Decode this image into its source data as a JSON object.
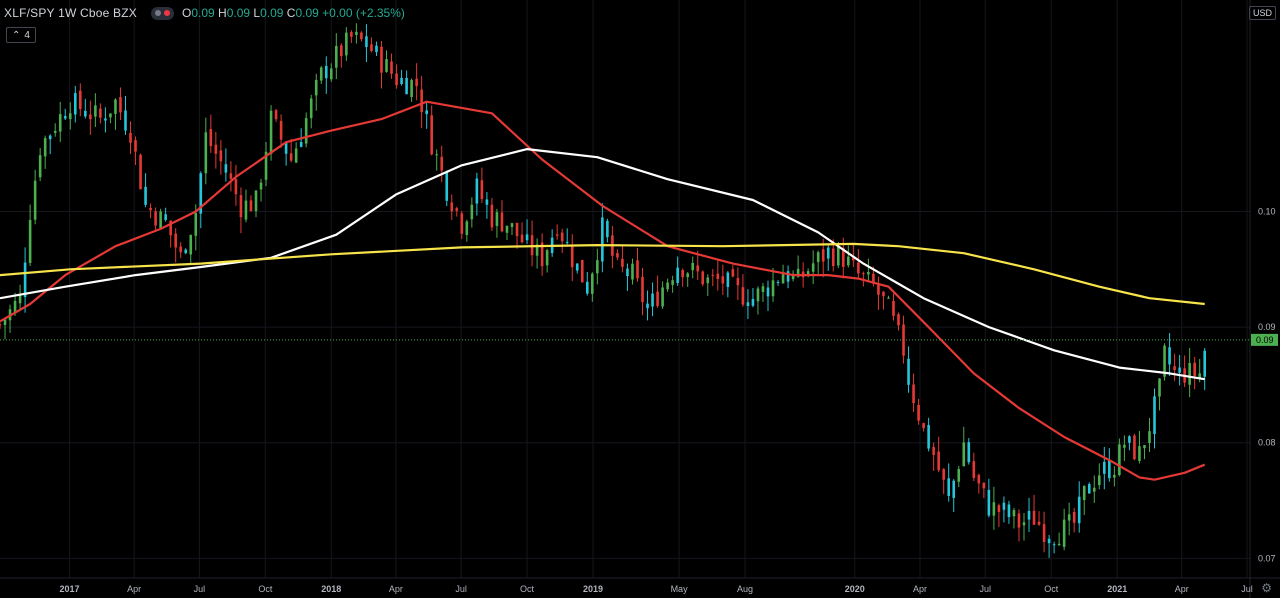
{
  "header": {
    "symbol_title": "XLF/SPY  1W  Cboe BZX",
    "ohlc": {
      "o_label": "O",
      "o": "0.09",
      "h_label": "H",
      "h": "0.09",
      "l_label": "L",
      "l": "0.09",
      "c_label": "C",
      "c": "0.09",
      "change": "+0.00 (+2.35%)"
    }
  },
  "indicators_collapse": {
    "count": "4"
  },
  "price_scale": {
    "currency": "USD",
    "last_price_label": "0.09",
    "last_price": 0.0889
  },
  "colors": {
    "background": "#000000",
    "up": "#4caf50",
    "up_alt": "#26c6da",
    "down": "#e53935",
    "ma_short": "#e53935",
    "ma_medium": "#ffffff",
    "ma_long": "#f7e34a",
    "last_price": "#4caf50"
  },
  "chart_data": {
    "type": "candlestick",
    "timeframe": "1W",
    "ylim": [
      0.0683,
      0.1183
    ],
    "y_ticks": [
      {
        "value": 0.1,
        "label": "0.10"
      },
      {
        "value": 0.09,
        "label": "0.09"
      },
      {
        "value": 0.08,
        "label": "0.08"
      },
      {
        "value": 0.07,
        "label": "0.07"
      }
    ],
    "x_range": [
      "2016-09-26",
      "2021-08-16"
    ],
    "x_ticks": [
      {
        "date": "2017-01-01",
        "label": "2017",
        "major": true
      },
      {
        "date": "2017-04-01",
        "label": "Apr"
      },
      {
        "date": "2017-07-01",
        "label": "Jul"
      },
      {
        "date": "2017-10-01",
        "label": "Oct"
      },
      {
        "date": "2018-01-01",
        "label": "2018",
        "major": true
      },
      {
        "date": "2018-04-01",
        "label": "Apr"
      },
      {
        "date": "2018-07-01",
        "label": "Jul"
      },
      {
        "date": "2018-10-01",
        "label": "Oct"
      },
      {
        "date": "2019-01-01",
        "label": "2019",
        "major": true
      },
      {
        "date": "2019-05-01",
        "label": "May"
      },
      {
        "date": "2019-08-01",
        "label": "Aug"
      },
      {
        "date": "2020-01-01",
        "label": "2020",
        "major": true
      },
      {
        "date": "2020-04-01",
        "label": "Apr"
      },
      {
        "date": "2020-07-01",
        "label": "Jul"
      },
      {
        "date": "2020-10-01",
        "label": "Oct"
      },
      {
        "date": "2021-01-01",
        "label": "2021",
        "major": true
      },
      {
        "date": "2021-04-01",
        "label": "Apr"
      },
      {
        "date": "2021-07-01",
        "label": "Jul"
      }
    ],
    "close_path": [
      [
        "2016-09-26",
        0.0902
      ],
      [
        "2016-10-24",
        0.0925
      ],
      [
        "2016-11-07",
        0.1001
      ],
      [
        "2016-11-21",
        0.1056
      ],
      [
        "2017-01-02",
        0.1095
      ],
      [
        "2017-02-13",
        0.108
      ],
      [
        "2017-03-06",
        0.1095
      ],
      [
        "2017-03-27",
        0.107
      ],
      [
        "2017-04-17",
        0.1005
      ],
      [
        "2017-05-15",
        0.099
      ],
      [
        "2017-06-05",
        0.096
      ],
      [
        "2017-06-26",
        0.1
      ],
      [
        "2017-07-10",
        0.1065
      ],
      [
        "2017-08-07",
        0.1035
      ],
      [
        "2017-08-28",
        0.1005
      ],
      [
        "2017-09-18",
        0.1008
      ],
      [
        "2017-10-09",
        0.108
      ],
      [
        "2017-11-06",
        0.1045
      ],
      [
        "2017-11-27",
        0.108
      ],
      [
        "2017-12-18",
        0.1118
      ],
      [
        "2018-01-29",
        0.115
      ],
      [
        "2018-02-19",
        0.1145
      ],
      [
        "2018-03-12",
        0.113
      ],
      [
        "2018-04-02",
        0.1115
      ],
      [
        "2018-04-30",
        0.111
      ],
      [
        "2018-05-21",
        0.106
      ],
      [
        "2018-06-11",
        0.102
      ],
      [
        "2018-07-02",
        0.099
      ],
      [
        "2018-07-23",
        0.102
      ],
      [
        "2018-08-13",
        0.0995
      ],
      [
        "2018-09-03",
        0.099
      ],
      [
        "2018-10-01",
        0.097
      ],
      [
        "2018-10-22",
        0.096
      ],
      [
        "2018-11-12",
        0.099
      ],
      [
        "2018-12-03",
        0.096
      ],
      [
        "2018-12-24",
        0.0935
      ],
      [
        "2019-01-14",
        0.0985
      ],
      [
        "2019-02-04",
        0.095
      ],
      [
        "2019-02-25",
        0.0945
      ],
      [
        "2019-03-18",
        0.0915
      ],
      [
        "2019-04-08",
        0.0935
      ],
      [
        "2019-04-29",
        0.0955
      ],
      [
        "2019-05-20",
        0.0948
      ],
      [
        "2019-06-10",
        0.094
      ],
      [
        "2019-07-01",
        0.094
      ],
      [
        "2019-07-22",
        0.093
      ],
      [
        "2019-08-12",
        0.0925
      ],
      [
        "2019-09-02",
        0.0935
      ],
      [
        "2019-09-23",
        0.0948
      ],
      [
        "2019-10-14",
        0.094
      ],
      [
        "2019-11-04",
        0.0955
      ],
      [
        "2019-11-25",
        0.0965
      ],
      [
        "2019-12-16",
        0.096
      ],
      [
        "2020-01-06",
        0.0945
      ],
      [
        "2020-01-27",
        0.0935
      ],
      [
        "2020-02-17",
        0.0915
      ],
      [
        "2020-03-09",
        0.088
      ],
      [
        "2020-03-16",
        0.0855
      ],
      [
        "2020-03-23",
        0.084
      ],
      [
        "2020-04-06",
        0.081
      ],
      [
        "2020-04-20",
        0.079
      ],
      [
        "2020-05-11",
        0.075
      ],
      [
        "2020-06-01",
        0.08
      ],
      [
        "2020-06-15",
        0.077
      ],
      [
        "2020-07-06",
        0.0745
      ],
      [
        "2020-07-27",
        0.074
      ],
      [
        "2020-08-17",
        0.073
      ],
      [
        "2020-09-07",
        0.0735
      ],
      [
        "2020-09-28",
        0.072
      ],
      [
        "2020-10-19",
        0.0725
      ],
      [
        "2020-11-02",
        0.073
      ],
      [
        "2020-11-16",
        0.0755
      ],
      [
        "2020-12-07",
        0.0775
      ],
      [
        "2020-12-28",
        0.078
      ],
      [
        "2021-01-11",
        0.08
      ],
      [
        "2021-02-01",
        0.079
      ],
      [
        "2021-02-15",
        0.0815
      ],
      [
        "2021-03-01",
        0.0845
      ],
      [
        "2021-03-08",
        0.0875
      ],
      [
        "2021-03-22",
        0.086
      ],
      [
        "2021-04-12",
        0.086
      ],
      [
        "2021-04-26",
        0.086
      ],
      [
        "2021-05-03",
        0.088
      ]
    ],
    "moving_averages": [
      {
        "color_key": "ma_short",
        "points": [
          [
            "2016-09-26",
            0.0905
          ],
          [
            "2016-11-07",
            0.092
          ],
          [
            "2016-12-26",
            0.0945
          ],
          [
            "2017-03-06",
            0.097
          ],
          [
            "2017-05-08",
            0.0985
          ],
          [
            "2017-06-26",
            0.1
          ],
          [
            "2017-08-21",
            0.103
          ],
          [
            "2017-10-30",
            0.106
          ],
          [
            "2018-01-01",
            0.107
          ],
          [
            "2018-03-12",
            0.108
          ],
          [
            "2018-05-14",
            0.1095
          ],
          [
            "2018-08-13",
            0.1085
          ],
          [
            "2018-10-22",
            0.1045
          ],
          [
            "2019-01-14",
            0.1005
          ],
          [
            "2019-04-15",
            0.097
          ],
          [
            "2019-07-15",
            0.0955
          ],
          [
            "2019-10-07",
            0.0945
          ],
          [
            "2019-11-25",
            0.0945
          ],
          [
            "2020-01-06",
            0.0942
          ],
          [
            "2020-02-17",
            0.0935
          ],
          [
            "2020-04-13",
            0.09
          ],
          [
            "2020-06-15",
            0.086
          ],
          [
            "2020-08-17",
            0.083
          ],
          [
            "2020-10-19",
            0.0805
          ],
          [
            "2020-12-21",
            0.0785
          ],
          [
            "2021-02-01",
            0.077
          ],
          [
            "2021-02-22",
            0.0768
          ],
          [
            "2021-04-05",
            0.0774
          ],
          [
            "2021-05-03",
            0.0781
          ]
        ]
      },
      {
        "color_key": "ma_medium",
        "points": [
          [
            "2016-09-26",
            0.0925
          ],
          [
            "2016-12-26",
            0.0935
          ],
          [
            "2017-04-03",
            0.0945
          ],
          [
            "2017-07-03",
            0.0952
          ],
          [
            "2017-10-09",
            0.096
          ],
          [
            "2018-01-08",
            0.098
          ],
          [
            "2018-04-02",
            0.1015
          ],
          [
            "2018-07-02",
            0.104
          ],
          [
            "2018-10-01",
            0.1054
          ],
          [
            "2019-01-07",
            0.1047
          ],
          [
            "2019-04-15",
            0.1028
          ],
          [
            "2019-08-12",
            0.101
          ],
          [
            "2019-11-11",
            0.0982
          ],
          [
            "2020-01-13",
            0.0955
          ],
          [
            "2020-04-06",
            0.0925
          ],
          [
            "2020-07-06",
            0.09
          ],
          [
            "2020-10-05",
            0.088
          ],
          [
            "2021-01-04",
            0.0865
          ],
          [
            "2021-03-15",
            0.086
          ],
          [
            "2021-05-03",
            0.0855
          ]
        ]
      },
      {
        "color_key": "ma_long",
        "points": [
          [
            "2016-09-26",
            0.0945
          ],
          [
            "2017-01-02",
            0.095
          ],
          [
            "2017-07-03",
            0.0955
          ],
          [
            "2018-01-01",
            0.0963
          ],
          [
            "2018-07-02",
            0.0969
          ],
          [
            "2019-01-07",
            0.0971
          ],
          [
            "2019-07-01",
            0.097
          ],
          [
            "2019-12-30",
            0.0972
          ],
          [
            "2020-03-02",
            0.097
          ],
          [
            "2020-06-01",
            0.0964
          ],
          [
            "2020-09-07",
            0.095
          ],
          [
            "2020-12-07",
            0.0935
          ],
          [
            "2021-02-15",
            0.0925
          ],
          [
            "2021-05-03",
            0.092
          ]
        ]
      }
    ]
  }
}
